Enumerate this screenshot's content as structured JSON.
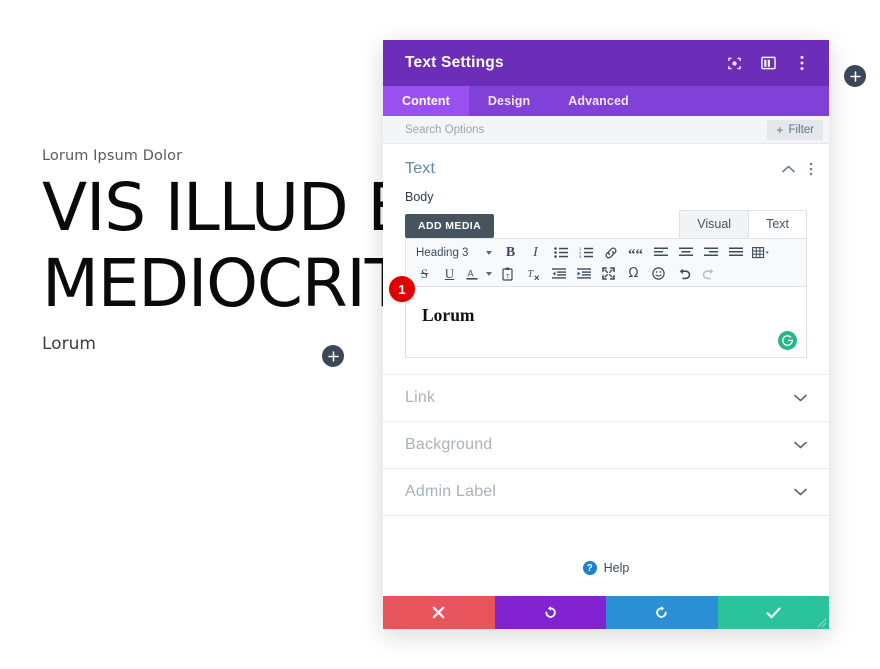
{
  "site": {
    "eyebrow": "Lorum Ipsum Dolor",
    "hero_title_line1": "VIS ILLUD EX",
    "hero_title_line2": "MEDIOCRITA",
    "body_text": "Lorum",
    "add_module_icon": "plus-icon",
    "add_global_icon": "plus-icon"
  },
  "modal": {
    "title": "Text Settings",
    "header_icons": [
      {
        "name": "focus-target-icon"
      },
      {
        "name": "layout-columns-icon"
      },
      {
        "name": "more-vertical-icon"
      }
    ],
    "tabs": [
      {
        "label": "Content",
        "active": true
      },
      {
        "label": "Design",
        "active": false
      },
      {
        "label": "Advanced",
        "active": false
      }
    ],
    "search": {
      "placeholder": "Search Options",
      "value": ""
    },
    "filter": {
      "label": "Filter",
      "icon": "plus-icon"
    },
    "text_section": {
      "title": "Text",
      "collapse_icon": "chevron-up-icon",
      "menu_icon": "more-vertical-icon",
      "field_label": "Body",
      "add_media_label": "Add Media",
      "editor_tabs": [
        {
          "label": "Visual",
          "active": true
        },
        {
          "label": "Text",
          "active": false
        }
      ],
      "format_select": "Heading 3",
      "toolbar_row1": [
        "bold-icon",
        "italic-icon",
        "bulleted-list-icon",
        "numbered-list-icon",
        "link-icon",
        "blockquote-icon",
        "align-left-icon",
        "align-center-icon",
        "align-right-icon",
        "align-justify-icon",
        "table-icon"
      ],
      "toolbar_row2": [
        "strikethrough-icon",
        "underline-icon",
        "text-color-icon",
        "paste-as-text-icon",
        "clear-formatting-icon",
        "outdent-icon",
        "indent-icon",
        "fullscreen-icon",
        "special-character-icon",
        "emoji-icon",
        "undo-icon",
        "redo-icon"
      ],
      "content": "Lorum",
      "grammarly_icon": "grammarly-icon",
      "step_badge": "1"
    },
    "accordions": [
      {
        "label": "Link",
        "icon": "chevron-down-icon"
      },
      {
        "label": "Background",
        "icon": "chevron-down-icon"
      },
      {
        "label": "Admin Label",
        "icon": "chevron-down-icon"
      }
    ],
    "help": {
      "label": "Help",
      "icon": "question-mark-icon"
    },
    "actions": [
      {
        "name": "cancel",
        "icon": "close-x-icon",
        "color": "#e8545b"
      },
      {
        "name": "undo",
        "icon": "undo-arrow-icon",
        "color": "#8223d2"
      },
      {
        "name": "redo",
        "icon": "redo-arrow-icon",
        "color": "#2a8fd4"
      },
      {
        "name": "save",
        "icon": "checkmark-icon",
        "color": "#2bc39b"
      }
    ]
  },
  "colors": {
    "header_purple": "#6c2eb9",
    "tabs_purple": "#8041d9",
    "tab_active_purple": "#9a4ff0",
    "badge_red": "#e00000",
    "grammarly_green": "#2cb48a"
  }
}
